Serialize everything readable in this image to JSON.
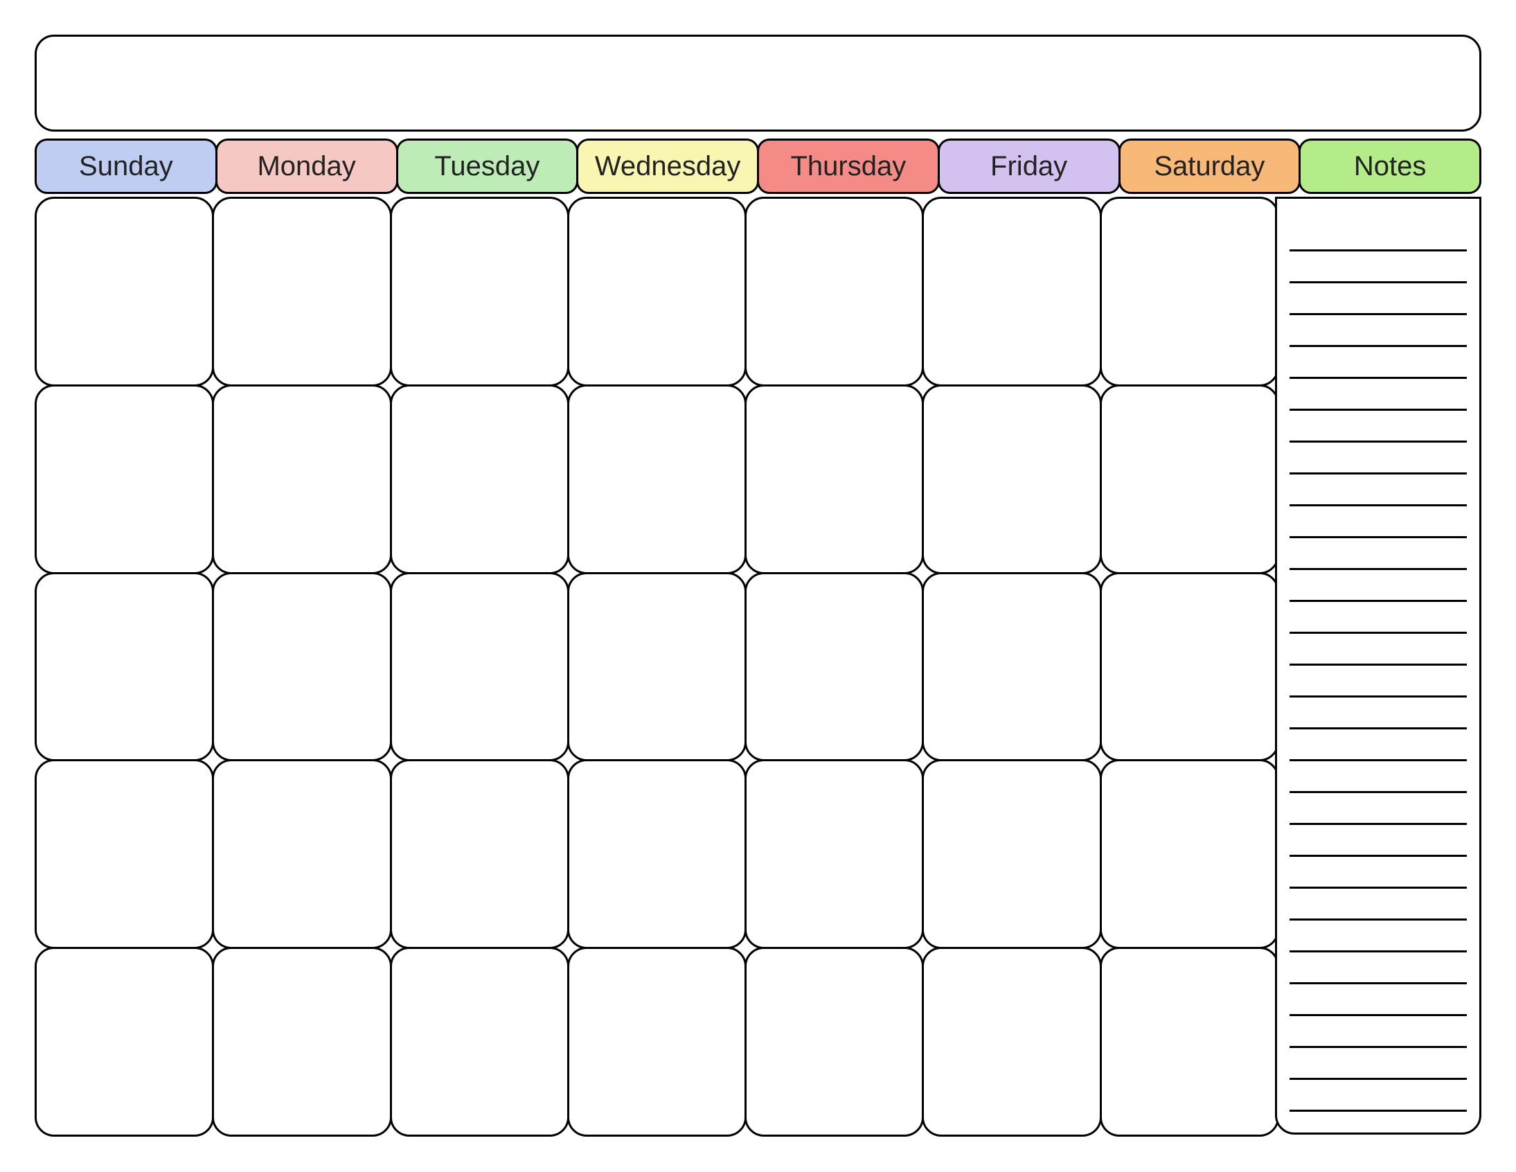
{
  "title": "",
  "headers": {
    "sunday": {
      "label": "Sunday",
      "color": "#bfcdf2"
    },
    "monday": {
      "label": "Monday",
      "color": "#f6c8c3"
    },
    "tuesday": {
      "label": "Tuesday",
      "color": "#bdecb6"
    },
    "wednesday": {
      "label": "Wednesday",
      "color": "#f8f6b0"
    },
    "thursday": {
      "label": "Thursday",
      "color": "#f58b87"
    },
    "friday": {
      "label": "Friday",
      "color": "#d3c2f0"
    },
    "saturday": {
      "label": "Saturday",
      "color": "#f7b878"
    },
    "notes": {
      "label": "Notes",
      "color": "#b5ec8a"
    }
  },
  "weeks": 5,
  "days_per_week": 7,
  "note_lines": 28
}
